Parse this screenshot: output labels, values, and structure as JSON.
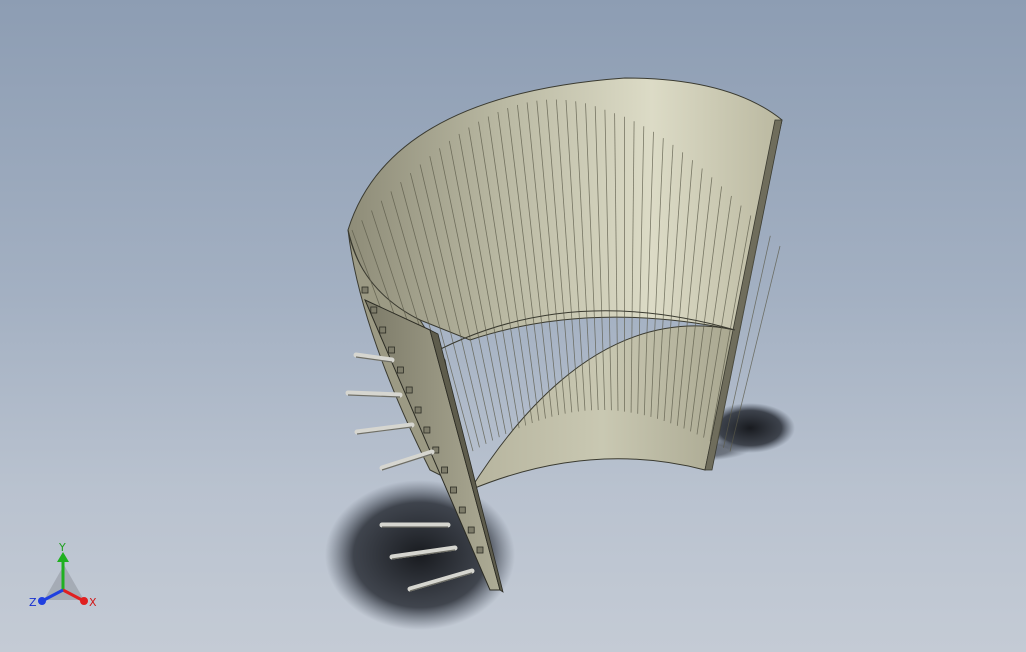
{
  "viewport": {
    "model": "curved-slotted-screen-panel",
    "colors": {
      "background_top": "#8d9db3",
      "background_bottom": "#c4cbd5",
      "model_face": "#c9c8b4",
      "model_shade": "#8e8c78",
      "edge": "#3a3a30",
      "shadow": "#1a1c22",
      "pin": "#d6d6d0"
    }
  },
  "triad": {
    "x_label": "X",
    "y_label": "Y",
    "z_label": "Z",
    "x_color": "#e02020",
    "y_color": "#20b020",
    "z_color": "#2040e0"
  }
}
